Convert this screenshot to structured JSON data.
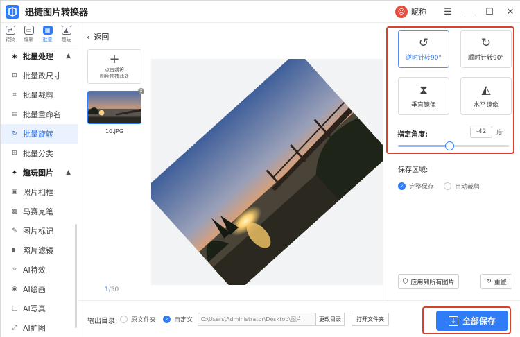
{
  "app": {
    "title": "迅捷图片转换器"
  },
  "user": {
    "nickname": "昵称"
  },
  "window": {
    "menu_icon": "menu-icon",
    "minimize_icon": "minimize-icon",
    "maximize_icon": "maximize-icon",
    "close_icon": "close-icon"
  },
  "modes": [
    {
      "label": "转换",
      "icon": "convert-icon"
    },
    {
      "label": "编辑",
      "icon": "edit-icon"
    },
    {
      "label": "批量",
      "icon": "batch-icon",
      "active": true
    },
    {
      "label": "趣玩",
      "icon": "fun-icon"
    }
  ],
  "sidebar": {
    "group1": "批量处理",
    "batch_items": [
      "批量改尺寸",
      "批量裁剪",
      "批量重命名",
      "批量旋转",
      "批量分类"
    ],
    "group2": "趣玩图片",
    "fun_items": [
      "照片相框",
      "马赛克笔",
      "图片标记",
      "照片滤镜",
      "AI特效",
      "AI绘画",
      "AI写真",
      "AI扩图"
    ],
    "active_item": "批量旋转"
  },
  "main": {
    "back_label": "返回",
    "add_hint": "点击或将\n图片拖拽此处",
    "thumb_name": "10.JPG",
    "page_current": "1",
    "page_total": "/50",
    "rotation_angle_deg": -42
  },
  "tools": {
    "rotate_left": "逆时针转90°",
    "rotate_right": "顺时针转90°",
    "flip_vertical": "垂直镜像",
    "flip_horizontal": "水平镜像",
    "angle_label": "指定角度:",
    "angle_value": "-42",
    "angle_unit": "度",
    "slider_fraction": 0.46
  },
  "save_area": {
    "label": "保存区域:",
    "option_full": "完整保存",
    "option_crop": "自动裁剪",
    "selected": "完整保存"
  },
  "actions": {
    "apply_all": "应用到所有图片",
    "reset": "重置"
  },
  "footer": {
    "output_label": "输出目录:",
    "option_source": "原文件夹",
    "option_custom": "自定义",
    "path": "C:\\Users\\Administrator\\Desktop\\图片",
    "change_dir": "更改目录",
    "open_folder": "打开文件夹",
    "save_all": "全部保存"
  },
  "colors": {
    "accent": "#2f7cf6",
    "highlight_box": "#d8412f"
  }
}
